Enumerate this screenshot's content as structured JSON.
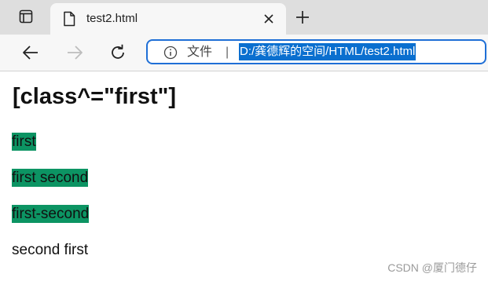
{
  "browser": {
    "tab": {
      "title": "test2.html"
    },
    "addressbar": {
      "site_label": "文件",
      "separator": "|",
      "url": "D:/龚德辉的空间/HTML/test2.html"
    },
    "icons": {
      "tab_actions": "tab-actions-icon",
      "favicon": "document-icon",
      "close": "close-icon",
      "new_tab": "plus-icon",
      "back": "arrow-left-icon",
      "forward": "arrow-right-icon",
      "refresh": "refresh-icon",
      "info": "info-icon"
    },
    "colors": {
      "tabstrip_bg": "#dedede",
      "toolbar_bg": "#f7f7f7",
      "address_border": "#1f6fd6",
      "url_selection": "#0a6fcf",
      "highlight": "#0c9463"
    }
  },
  "page": {
    "heading": "[class^=\"first\"]",
    "paragraphs": [
      {
        "text": "first",
        "highlighted": true
      },
      {
        "text": "first second",
        "highlighted": true
      },
      {
        "text": "first-second",
        "highlighted": true
      },
      {
        "text": "second first",
        "highlighted": false
      }
    ],
    "watermark": "CSDN @厦门德仔"
  }
}
